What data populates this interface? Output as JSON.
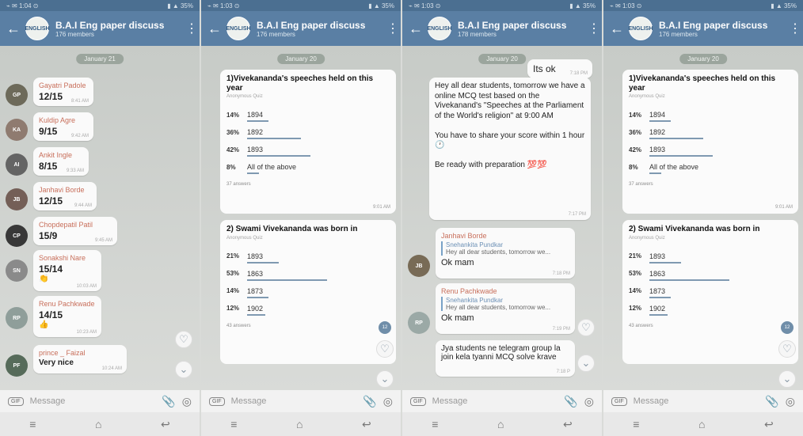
{
  "screens": [
    {
      "title": "B.A.I Eng paper discuss",
      "members": "176 members",
      "date": "January 21",
      "messages": [
        {
          "name": "Gayatri Padole",
          "text": "12/15",
          "time": "8:41 AM"
        },
        {
          "name": "Kuldip Agre",
          "text": "9/15",
          "time": "9:42 AM"
        },
        {
          "name": "Ankit Ingle",
          "text": "8/15",
          "time": "9:33 AM"
        },
        {
          "name": "Janhavi Borde",
          "text": "12/15",
          "time": "9:44 AM"
        },
        {
          "name": "Chopdepatil Patil",
          "text": "15/9",
          "time": "9:45 AM"
        },
        {
          "name": "Sonakshi Nare",
          "text": "15/14",
          "time": "10:03 AM"
        },
        {
          "name": "Renu Pachkwade",
          "text": "14/15",
          "time": "10:23 AM"
        },
        {
          "name": "prince _ Faizal",
          "text": "Very nice",
          "time": "10:24 AM"
        }
      ],
      "input_placeholder": "Message"
    },
    {
      "title": "B.A.I Eng paper discuss",
      "members": "176 members",
      "date": "January 20",
      "quiz1": {
        "question": "1)Vivekananda's speeches held on this year",
        "anon": "Anonymous Quiz",
        "options": [
          {
            "pct": "14%",
            "label": "1894",
            "value": 14
          },
          {
            "pct": "36%",
            "label": "1892",
            "value": 36
          },
          {
            "pct": "42%",
            "label": "1893",
            "value": 42
          },
          {
            "pct": "8%",
            "label": "All of the above",
            "value": 8
          }
        ],
        "answers": "37 answers",
        "time": "9:01 AM"
      },
      "quiz2": {
        "question": "2) Swami Vivekananda was born in",
        "anon": "Anonymous Quiz",
        "options": [
          {
            "pct": "21%",
            "label": "1893",
            "value": 21
          },
          {
            "pct": "53%",
            "label": "1863",
            "value": 53
          },
          {
            "pct": "14%",
            "label": "1873",
            "value": 14
          },
          {
            "pct": "12%",
            "label": "1902",
            "value": 12
          }
        ],
        "answers": "43 answers"
      },
      "badge": "12",
      "input_placeholder": "Message"
    },
    {
      "title": "B.A.I Eng paper discuss",
      "members": "178 members",
      "date": "January 20",
      "messages": [
        {
          "text": "Its ok",
          "time": "7:18 PM"
        },
        {
          "text": "Hey all dear students, tomorrow we have a online MCQ test based on the Vivekanand's \"Speeches at the Parliament of the World's religion\" at 9:00 AM\n\nYou have to share your score within 1 hour 🕐\n\nBe ready with preparation 💯💯",
          "time": "7:17 PM"
        },
        {
          "name": "Janhavi Borde",
          "reply_name": "Snehankita Pundkar",
          "reply": "Hey all dear students, tomorrow we...",
          "text": "Ok mam",
          "time": "7:18 PM"
        },
        {
          "name": "Renu Pachkwade",
          "reply_name": "Snehankita Pundkar",
          "reply": "Hey all dear students, tomorrow we...",
          "text": "Ok mam",
          "time": "7:19 PM"
        },
        {
          "text": "Jya students ne telegram group la join kela tyanni MCQ solve krave",
          "time": "7:18 P"
        }
      ],
      "input_placeholder": "Message"
    },
    {
      "title": "B.A.I Eng paper discuss",
      "members": "176 members",
      "date": "January 20",
      "quiz1": {
        "question": "1)Vivekananda's speeches held on this year",
        "anon": "Anonymous Quiz",
        "options": [
          {
            "pct": "14%",
            "label": "1894",
            "value": 14
          },
          {
            "pct": "36%",
            "label": "1892",
            "value": 36
          },
          {
            "pct": "42%",
            "label": "1893",
            "value": 42
          },
          {
            "pct": "8%",
            "label": "All of the above",
            "value": 8
          }
        ],
        "answers": "37 answers",
        "time": "9:01 AM"
      },
      "quiz2": {
        "question": "2) Swami Vivekananda was born in",
        "anon": "Anonymous Quiz",
        "options": [
          {
            "pct": "21%",
            "label": "1893",
            "value": 21
          },
          {
            "pct": "53%",
            "label": "1863",
            "value": 53
          },
          {
            "pct": "14%",
            "label": "1873",
            "value": 14
          },
          {
            "pct": "12%",
            "label": "1902",
            "value": 12
          }
        ],
        "answers": "43 answers"
      },
      "badge": "12",
      "input_placeholder": "Message"
    }
  ]
}
